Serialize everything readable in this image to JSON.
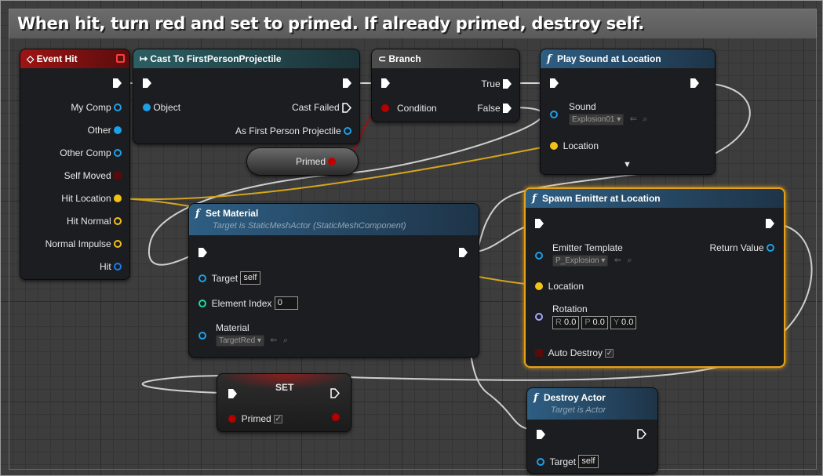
{
  "comment": {
    "title": "When hit, turn red and set to primed. If already primed, destroy self."
  },
  "event_hit": {
    "title": "Event Hit",
    "pins": [
      "My Comp",
      "Other",
      "Other Comp",
      "Self Moved",
      "Hit Location",
      "Hit Normal",
      "Normal Impulse",
      "Hit"
    ]
  },
  "cast": {
    "title": "Cast To FirstPersonProjectile",
    "object_label": "Object",
    "cast_failed_label": "Cast Failed",
    "as_label": "As First Person Projectile"
  },
  "primed_var": {
    "label": "Primed"
  },
  "branch": {
    "title": "Branch",
    "true_label": "True",
    "false_label": "False",
    "condition_label": "Condition"
  },
  "play_sound": {
    "title": "Play Sound at Location",
    "sound_label": "Sound",
    "sound_value": "Explosion01",
    "location_label": "Location"
  },
  "set_material": {
    "title": "Set Material",
    "subtitle": "Target is StaticMeshActor (StaticMeshComponent)",
    "target_label": "Target",
    "target_value": "self",
    "element_index_label": "Element Index",
    "element_index_value": "0",
    "material_label": "Material",
    "material_value": "TargetRed"
  },
  "spawn_emitter": {
    "title": "Spawn Emitter at Location",
    "emitter_label": "Emitter Template",
    "emitter_value": "P_Explosion",
    "return_label": "Return Value",
    "location_label": "Location",
    "rotation_label": "Rotation",
    "rotation": {
      "r_label": "R",
      "r_value": "0.0",
      "p_label": "P",
      "p_value": "0.0",
      "y_label": "Y",
      "y_value": "0.0"
    },
    "auto_destroy_label": "Auto Destroy"
  },
  "set_node": {
    "title": "SET",
    "primed_label": "Primed"
  },
  "destroy": {
    "title": "Destroy Actor",
    "subtitle": "Target is Actor",
    "target_label": "Target",
    "target_value": "self"
  },
  "icons": {
    "checkmark": "✓",
    "dropdown_arrow": "▾",
    "expand_arrow": "▼",
    "browse": "⇐",
    "search": "⌕"
  },
  "colors": {
    "exec": "#ffffff",
    "object_pin": "#1ea0e8",
    "struct_vector": "#f3c218",
    "struct_rotator": "#a4a8ff",
    "bool_pin": "#b50000",
    "int_pin": "#1edb9b",
    "selected_border": "#e6a11a"
  }
}
